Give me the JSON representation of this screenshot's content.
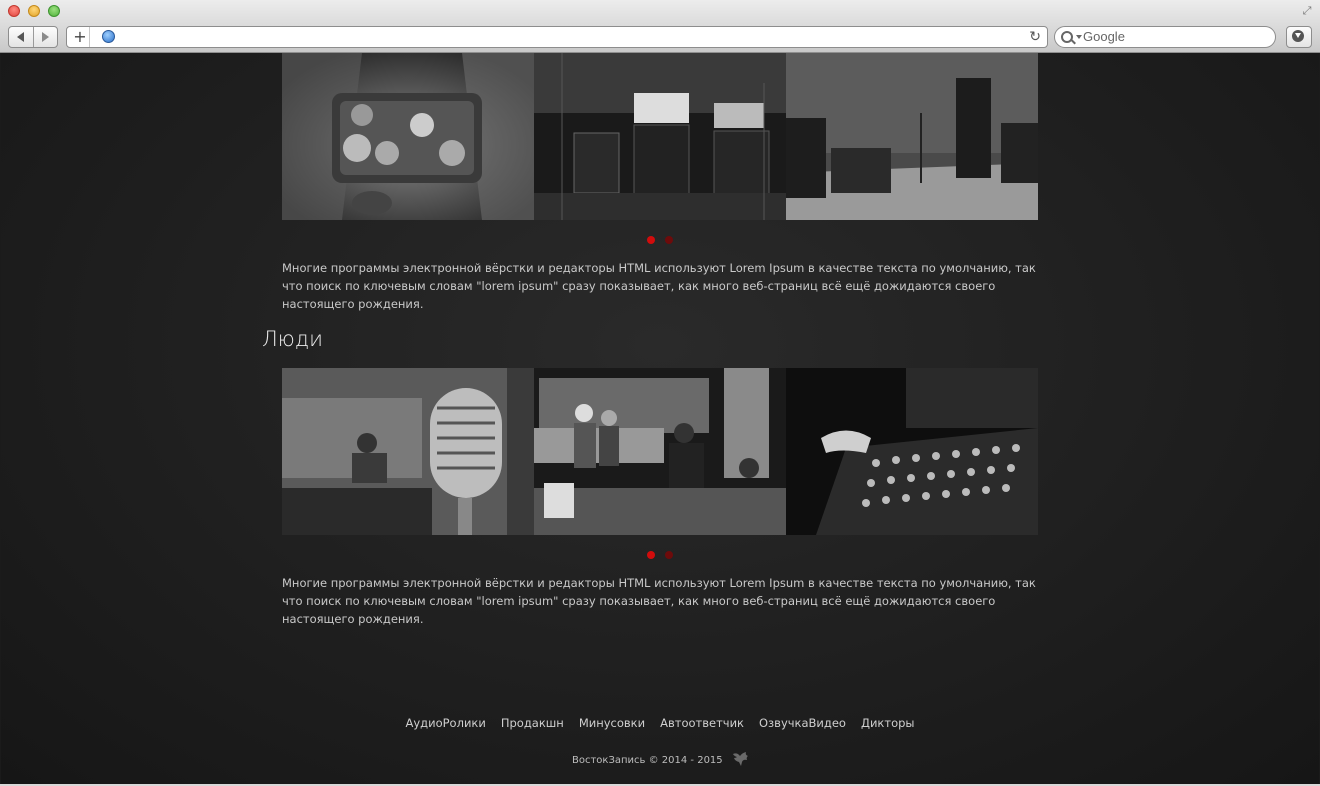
{
  "browser": {
    "back_icon": "back-arrow-icon",
    "forward_icon": "forward-arrow-icon",
    "address_value": "",
    "search_placeholder": "Google"
  },
  "gallery_one": {
    "photos": [
      "tea-ceremony-photo",
      "amplifiers-studio-photo",
      "rehearsal-room-photo"
    ],
    "dots": 2,
    "active_dot": 0,
    "description": "Многие программы электронной вёрстки и редакторы HTML используют Lorem Ipsum в качестве текста по умолчанию, так что поиск по ключевым словам \"lorem ipsum\" сразу показывает, как много веб-страниц всё ещё дожидаются своего настоящего рождения."
  },
  "people": {
    "title": "Люди",
    "photos": [
      "microphone-photo",
      "control-room-photo",
      "mixing-console-photo"
    ],
    "dots": 2,
    "active_dot": 0,
    "description": "Многие программы электронной вёрстки и редакторы HTML используют Lorem Ipsum в качестве текста по умолчанию, так что поиск по ключевым словам \"lorem ipsum\" сразу показывает, как много веб-страниц всё ещё дожидаются своего настоящего рождения."
  },
  "footer": {
    "nav": [
      "АудиоРолики",
      "Продакшн",
      "Минусовки",
      "Автоответчик",
      "ОзвучкаВидео",
      "Дикторы"
    ],
    "copyright": "ВостокЗапись © 2014 - 2015",
    "logo_icon": "bird-icon"
  },
  "colors": {
    "accent": "#d10c0c",
    "background": "#1f1f1f",
    "text": "#c9c9c9"
  }
}
